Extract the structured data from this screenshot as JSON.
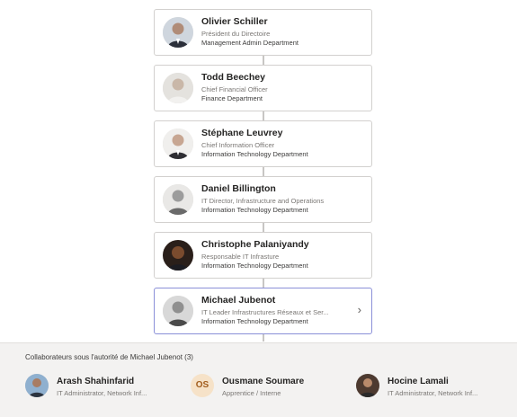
{
  "org_chart": [
    {
      "name": "Olivier Schiller",
      "title": "Président du Directoire",
      "department": "Management Admin Department",
      "avatar_icon": "person-photo"
    },
    {
      "name": "Todd Beechey",
      "title": "Chief Financial Officer",
      "department": "Finance Department",
      "avatar_icon": "person-photo"
    },
    {
      "name": "Stéphane Leuvrey",
      "title": "Chief Information Officer",
      "department": "Information Technology Department",
      "avatar_icon": "person-photo"
    },
    {
      "name": "Daniel Billington",
      "title": "IT Director, Infrastructure and Operations",
      "department": "Information Technology Department",
      "avatar_icon": "person-photo"
    },
    {
      "name": "Christophe Palaniyandy",
      "title": "Responsable IT Infrasture",
      "department": "Information Technology Department",
      "avatar_icon": "person-photo"
    },
    {
      "name": "Michael Jubenot",
      "title": "IT Leader Infrastructures Réseaux et Ser...",
      "department": "Information Technology Department",
      "avatar_icon": "person-photo",
      "chevron": "›"
    }
  ],
  "direct_reports": {
    "heading": "Collaborateurs sous l'autorité de Michael Jubenot (3)",
    "items": [
      {
        "name": "Arash Shahinfarid",
        "title": "IT Administrator, Network Inf...",
        "avatar_icon": "person-photo"
      },
      {
        "name": "Ousmane Soumare",
        "title": "Apprentice / Interne",
        "initials": "OS"
      },
      {
        "name": "Hocine Lamali",
        "title": "IT Administrator, Network Inf...",
        "avatar_icon": "person-photo"
      }
    ]
  },
  "colors": {
    "card_border": "#d2d0ce",
    "selected_border": "#8a8fd8",
    "connector": "#c8c6c4",
    "panel_bg": "#f3f2f1",
    "initials_bg": "#f6e2c8"
  }
}
